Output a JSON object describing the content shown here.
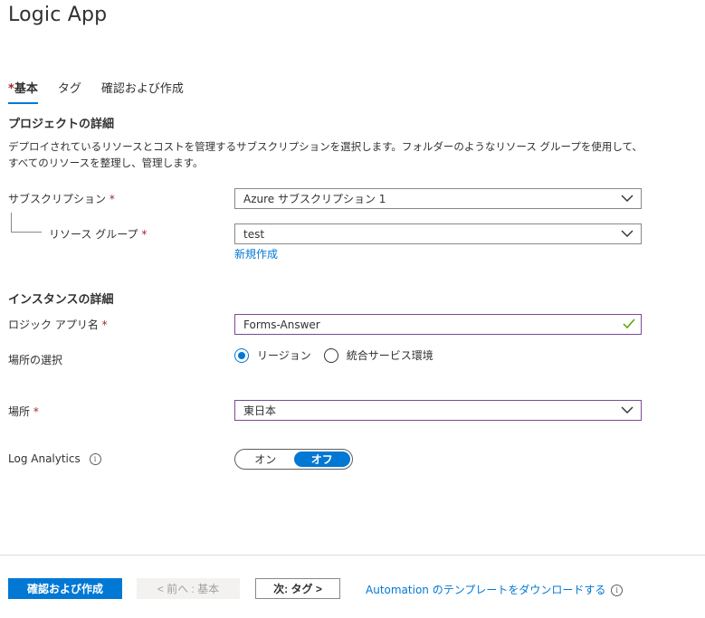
{
  "page": {
    "title": "Logic App"
  },
  "tabs": [
    {
      "label": "基本",
      "required": "*",
      "active": true
    },
    {
      "label": "タグ"
    },
    {
      "label": "確認および作成"
    }
  ],
  "project": {
    "heading": "プロジェクトの詳細",
    "description": "デプロイされているリソースとコストを管理するサブスクリプションを選択します。フォルダーのようなリソース グループを使用して、すべてのリソースを整理し、管理します。",
    "subscription_label": "サブスクリプション",
    "subscription_value": "Azure サブスクリプション 1",
    "resource_group_label": "リソース グループ",
    "resource_group_value": "test",
    "create_new_link": "新規作成"
  },
  "instance": {
    "heading": "インスタンスの詳細",
    "name_label": "ロジック アプリ名",
    "name_value": "Forms-Answer",
    "location_type_label": "場所の選択",
    "radio_region": "リージョン",
    "radio_ise": "統合サービス環境",
    "location_label": "場所",
    "location_value": "東日本",
    "log_analytics_label": "Log Analytics",
    "toggle_on": "オン",
    "toggle_off": "オフ",
    "toggle_selected": "オフ"
  },
  "required_mark": "*",
  "info_glyph": "i",
  "footer": {
    "review_create": "確認および作成",
    "previous": "< 前へ : 基本",
    "next": "次: タグ >",
    "download_link": "Automation のテンプレートをダウンロードする"
  },
  "colors": {
    "accent": "#0078d4",
    "required": "#a4262c",
    "valid": "#57a300",
    "focus_border": "#7a4b94"
  },
  "icons": {
    "dropdown": "chevron-down-icon",
    "valid": "checkmark-icon",
    "info": "info-icon"
  }
}
